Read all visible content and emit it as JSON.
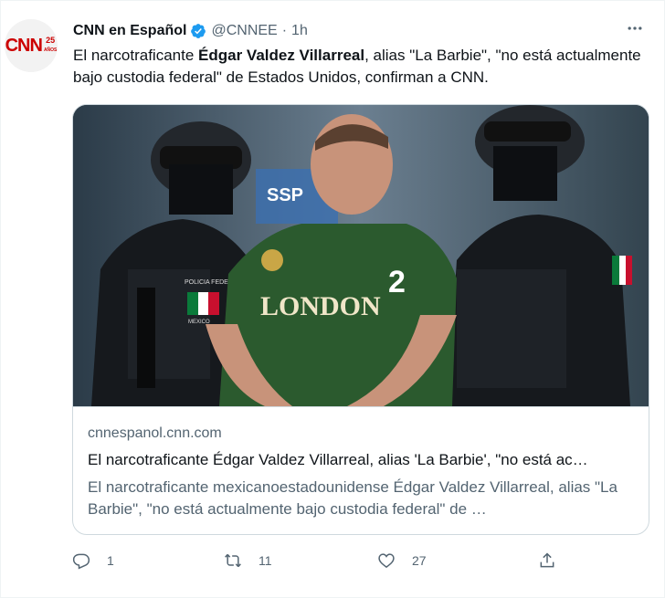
{
  "tweet": {
    "author_name": "CNN en Español",
    "handle": "@CNNEE",
    "separator": "·",
    "time": "1h",
    "avatar": {
      "logo_text": "CNN",
      "badge_text": "25",
      "badge_sub": "AÑOS",
      "brand_color": "#cc0000"
    },
    "text_before": "El narcotraficante ",
    "text_bold": "Édgar Valdez Villarreal",
    "text_after": ", alias \"La Barbie\", \"no está actualmente bajo custodia federal\" de Estados Unidos, confirman a CNN.",
    "more_icon": "more-dots-icon",
    "verified_color": "#1d9bf0"
  },
  "card": {
    "domain": "cnnespanol.cnn.com",
    "title": "El narcotraficante Édgar Valdez Villarreal, alias 'La Barbie', \"no está ac…",
    "description": "El narcotraficante mexicanoestadounidense Édgar Valdez Villarreal, alias \"La Barbie\", \"no está actualmente bajo custodia federal\" de …",
    "photo": {
      "shirt_text": "LONDON",
      "shirt_number": "2",
      "police_patch_text": "POLICIA FEDERAL",
      "patch_country": "MEXICO",
      "sign_text": "SSP"
    }
  },
  "actions": {
    "reply_count": "1",
    "retweet_count": "11",
    "like_count": "27"
  }
}
